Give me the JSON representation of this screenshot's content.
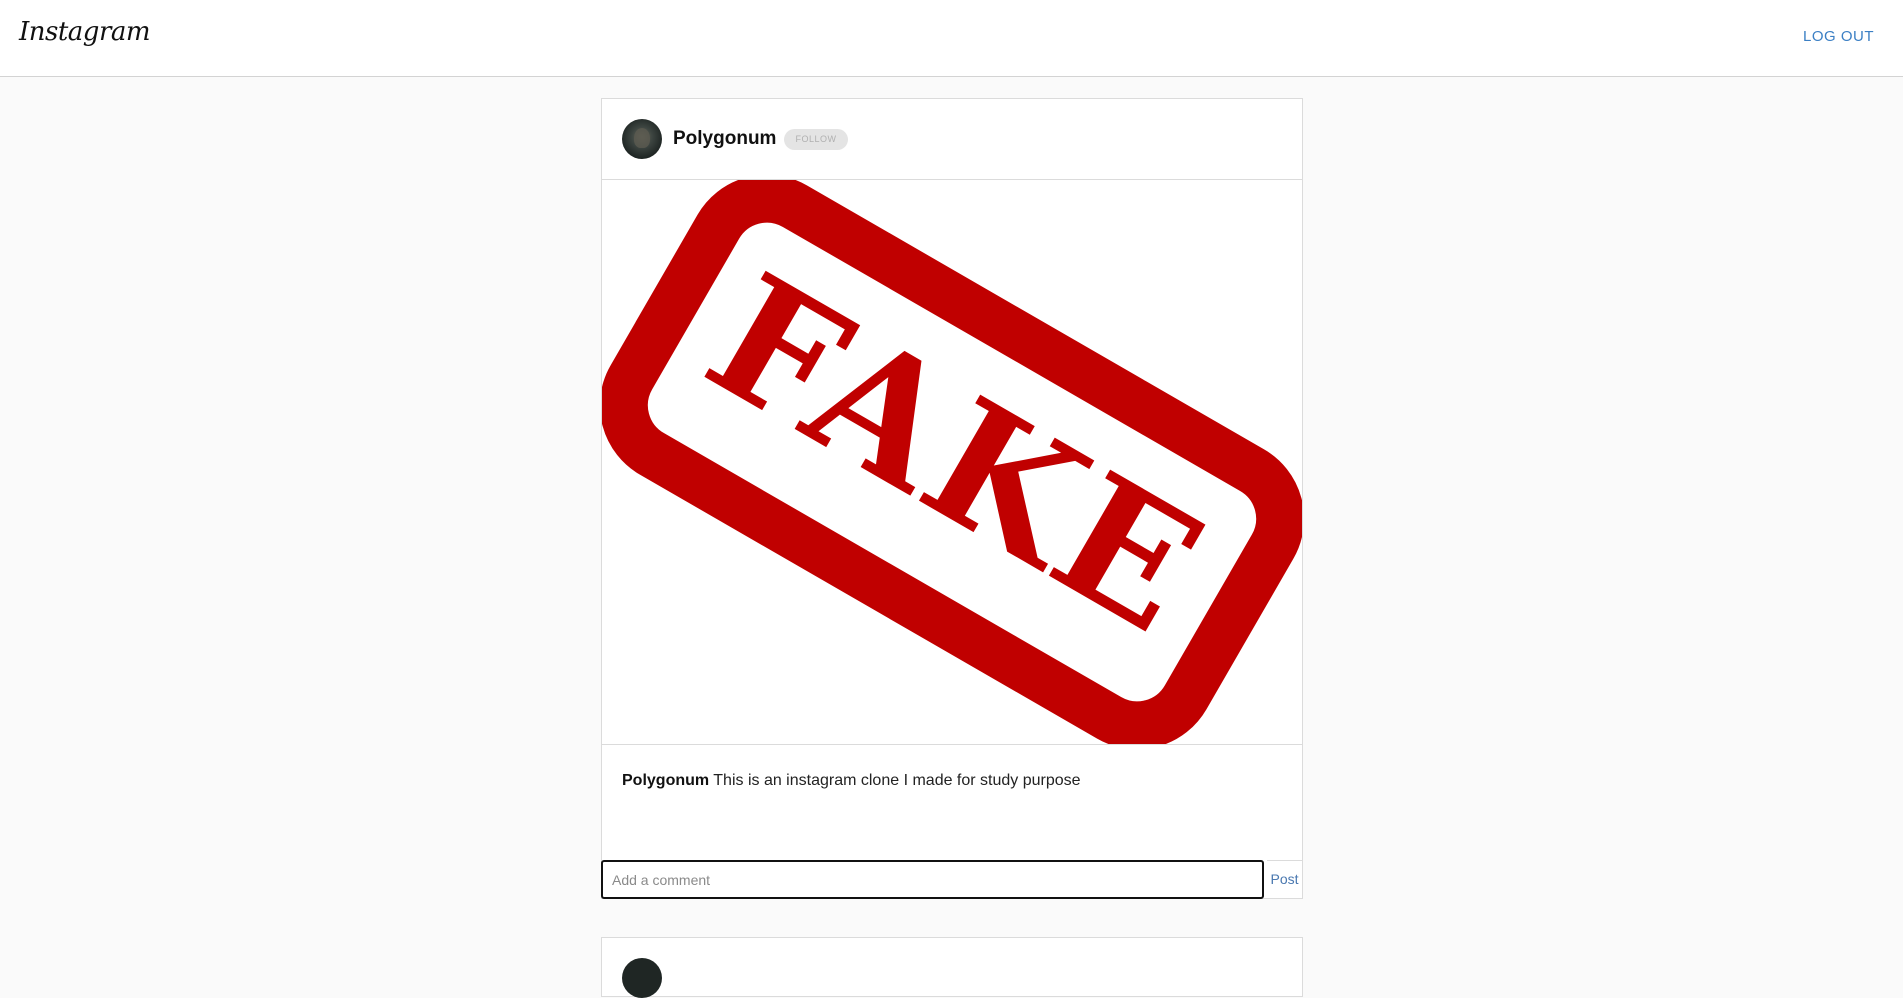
{
  "header": {
    "logo": "Instagram",
    "logout_label": "LOG OUT"
  },
  "posts": [
    {
      "username": "Polygonum",
      "follow_label": "FOLLOW",
      "image": {
        "stamp_text": "FAKE",
        "stamp_color": "#c00000"
      },
      "caption_user": "Polygonum",
      "caption_text": "This is an instagram clone I made for study purpose",
      "comment_placeholder": "Add a comment",
      "comment_value": "",
      "post_label": "Post"
    }
  ],
  "colors": {
    "link": "#3b7fc4",
    "border": "#dbdbdb",
    "background": "#fafafa"
  }
}
